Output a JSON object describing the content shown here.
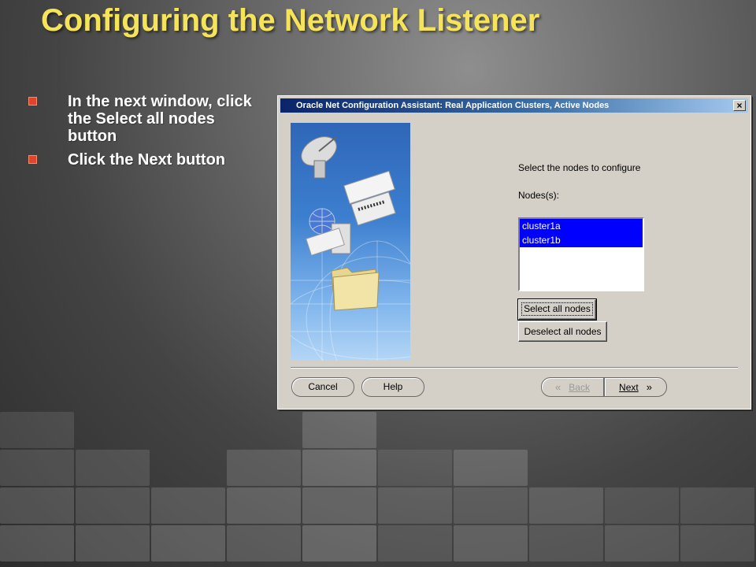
{
  "slide": {
    "title": "Configuring the Network Listener",
    "bullets": [
      "In the next window, click the Select all nodes button",
      "Click the Next button"
    ]
  },
  "dialog": {
    "title": "Oracle Net Configuration Assistant: Real Application Clusters, Active Nodes",
    "close_glyph": "×",
    "prompt": "Select the nodes to configure",
    "nodes_label": "Nodes(s):",
    "nodes": [
      "cluster1a",
      "cluster1b"
    ],
    "select_all_label": "Select all nodes",
    "deselect_all_label": "Deselect all nodes",
    "buttons": {
      "cancel": "Cancel",
      "help": "Help",
      "back": "Back",
      "next": "Next",
      "back_glyph": "«",
      "next_glyph": "»"
    }
  },
  "icons": {
    "bullet": "square-bullet",
    "close": "close-icon",
    "back": "chevron-left-icon",
    "next": "chevron-right-icon"
  },
  "colors": {
    "title": "#f5e35a",
    "bullet_mark": "#e0442a",
    "selection": "#0000ff",
    "titlebar": "#0a246a"
  }
}
